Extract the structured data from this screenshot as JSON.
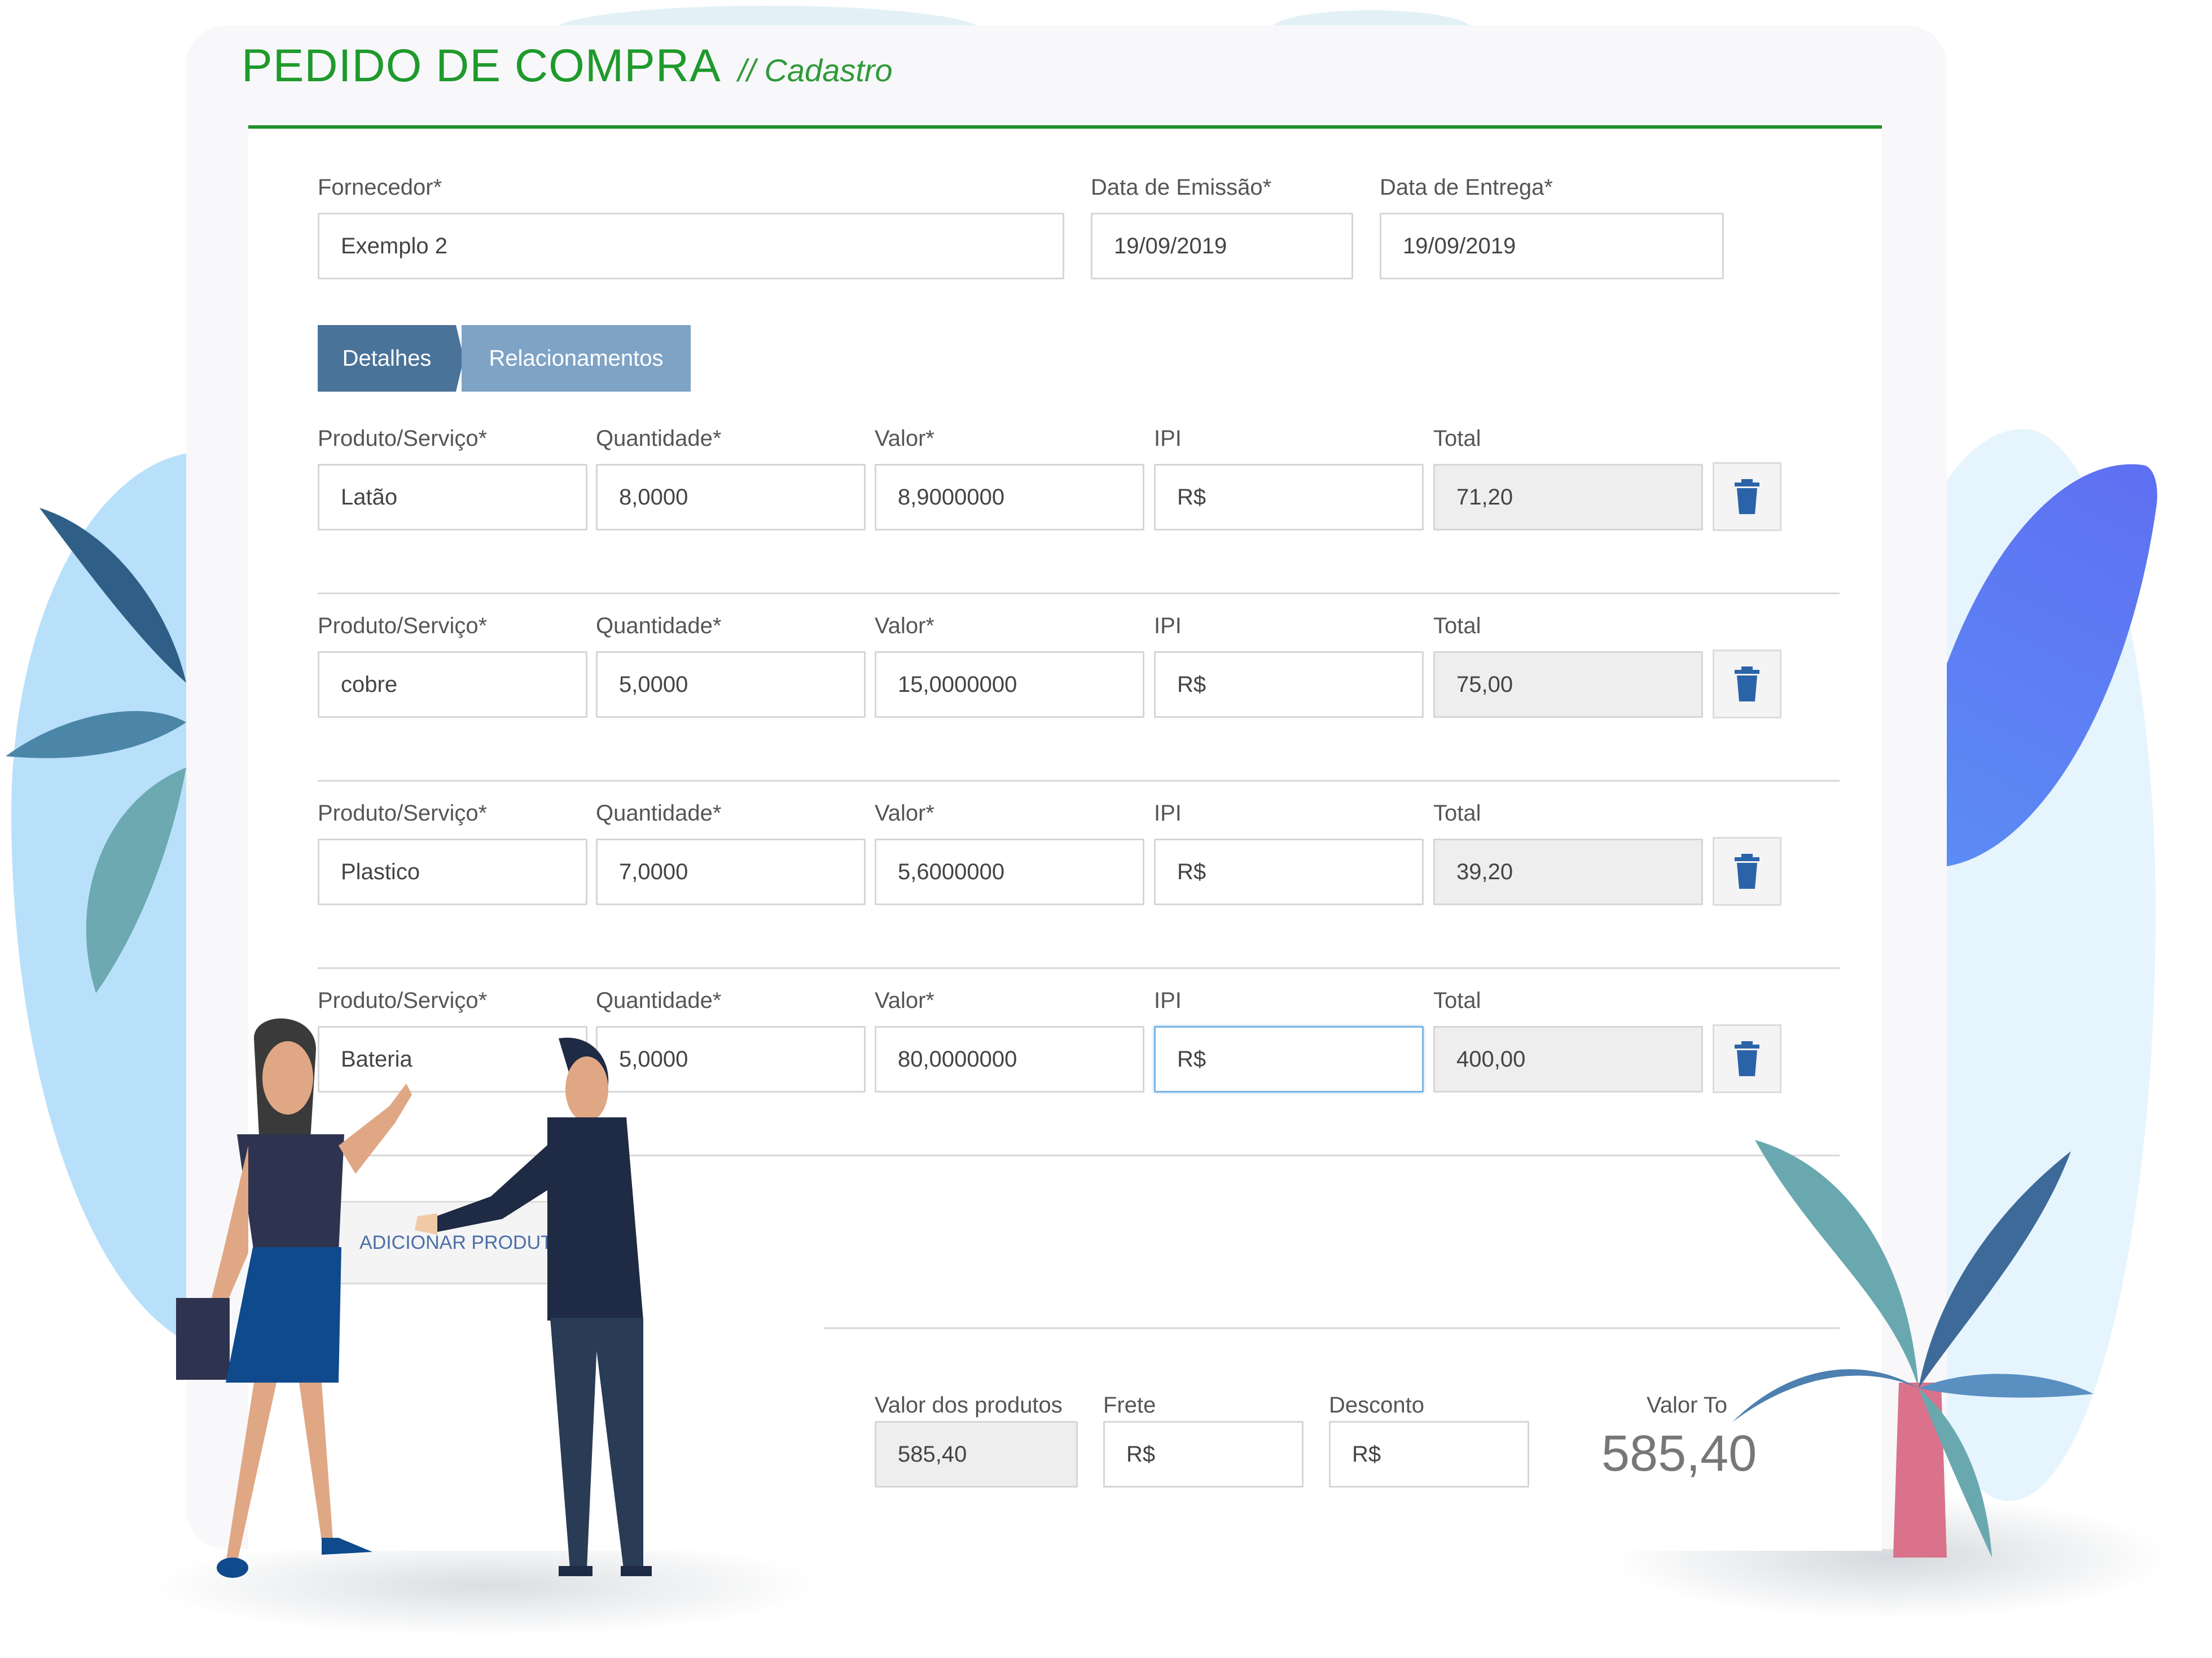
{
  "header": {
    "title": "PEDIDO DE COMPRA",
    "subtitle": "// Cadastro"
  },
  "fornecedor": {
    "label": "Fornecedor*",
    "value": "Exemplo 2"
  },
  "data_emissao": {
    "label": "Data de Emissão*",
    "value": "19/09/2019"
  },
  "data_entrega": {
    "label": "Data de Entrega*",
    "value": "19/09/2019"
  },
  "tabs": [
    {
      "label": "Detalhes"
    },
    {
      "label": "Relacionamentos"
    }
  ],
  "columns": {
    "produto": "Produto/Serviço*",
    "quantidade": "Quantidade*",
    "valor": "Valor*",
    "ipi": "IPI",
    "total": "Total"
  },
  "items": [
    {
      "produto": "Latão",
      "quantidade": "8,0000",
      "valor": "8,9000000",
      "ipi": "R$",
      "total": "71,20"
    },
    {
      "produto": "cobre",
      "quantidade": "5,0000",
      "valor": "15,0000000",
      "ipi": "R$",
      "total": "75,00"
    },
    {
      "produto": "Plastico",
      "quantidade": "7,0000",
      "valor": "5,6000000",
      "ipi": "R$",
      "total": "39,20"
    },
    {
      "produto": "Bateria",
      "quantidade": "5,0000",
      "valor": "80,0000000",
      "ipi": "R$",
      "total": "400,00"
    }
  ],
  "add_button": "ADICIONAR PRODUTO",
  "summary": {
    "valor_produtos_label": "Valor dos produtos",
    "valor_produtos": "585,40",
    "frete_label": "Frete",
    "frete": "R$",
    "desconto_label": "Desconto",
    "desconto": "R$",
    "valor_total_label": "Valor To",
    "valor_total": "585,40"
  },
  "colors": {
    "accent_green": "#1f9a2c",
    "tab_active": "#4a7399",
    "tab_inactive": "#7fa3c5",
    "trash_icon": "#2b63a8"
  },
  "icons": {
    "delete": "trash-icon"
  }
}
